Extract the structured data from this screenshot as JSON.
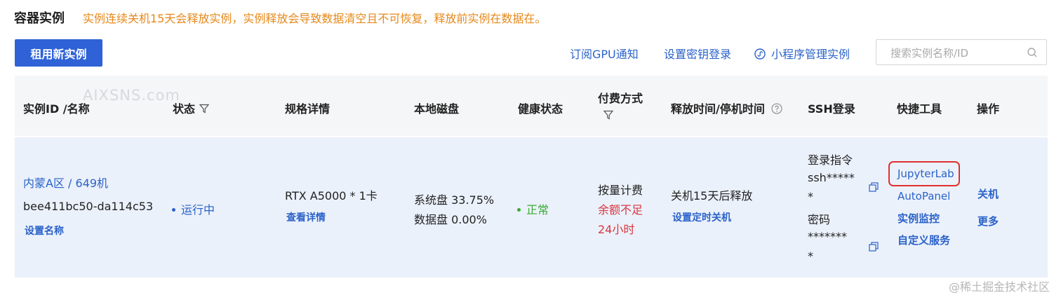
{
  "page": {
    "title": "容器实例",
    "warning": "实例连续关机15天会释放实例，实例释放会导致数据清空且不可恢复，释放前实例在数据在。"
  },
  "toolbar": {
    "rent_button": "租用新实例",
    "subscribe_gpu": "订阅GPU通知",
    "set_key_login": "设置密钥登录",
    "mini_program": "小程序管理实例",
    "search_placeholder": "搜索实例名称/ID"
  },
  "table": {
    "columns": {
      "instance": "实例ID /名称",
      "status": "状态",
      "spec": "规格详情",
      "disk": "本地磁盘",
      "health": "健康状态",
      "payment": "付费方式",
      "release": "释放时间/停机时间",
      "ssh": "SSH登录",
      "tools": "快捷工具",
      "actions": "操作"
    },
    "rows": [
      {
        "region": "内蒙A区 / 649机",
        "id": "bee411bc50-da114c53",
        "set_name": "设置名称",
        "status": "运行中",
        "status_color": "#2a62c9",
        "spec": "RTX A5000 * 1卡",
        "view_detail": "查看详情",
        "sys_disk": "系统盘 33.75%",
        "data_disk": "数据盘 0.00%",
        "health": "正常",
        "health_color": "#3aaa35",
        "payment": "按量计费",
        "balance_line1": "余额不足",
        "balance_line2": "24小时",
        "release": "关机15天后释放",
        "set_timer": "设置定时关机",
        "ssh_label": "登录指令",
        "ssh_cmd_line1": "ssh*****",
        "ssh_cmd_line2": "*",
        "pwd_label": "密码",
        "pwd_line1": "*******",
        "pwd_line2": "*",
        "tools": [
          "JupyterLab",
          "AutoPanel",
          "实例监控",
          "自定义服务"
        ],
        "actions": [
          "关机",
          "更多"
        ]
      }
    ]
  },
  "watermark": "AIXSNS.com",
  "footer_watermark": "@稀土掘金技术社区",
  "colors": {
    "primary": "#2f62d6",
    "link": "#2a62c9",
    "warning": "#e6881a",
    "danger": "#d9363e",
    "highlight_border": "#e0302c"
  }
}
